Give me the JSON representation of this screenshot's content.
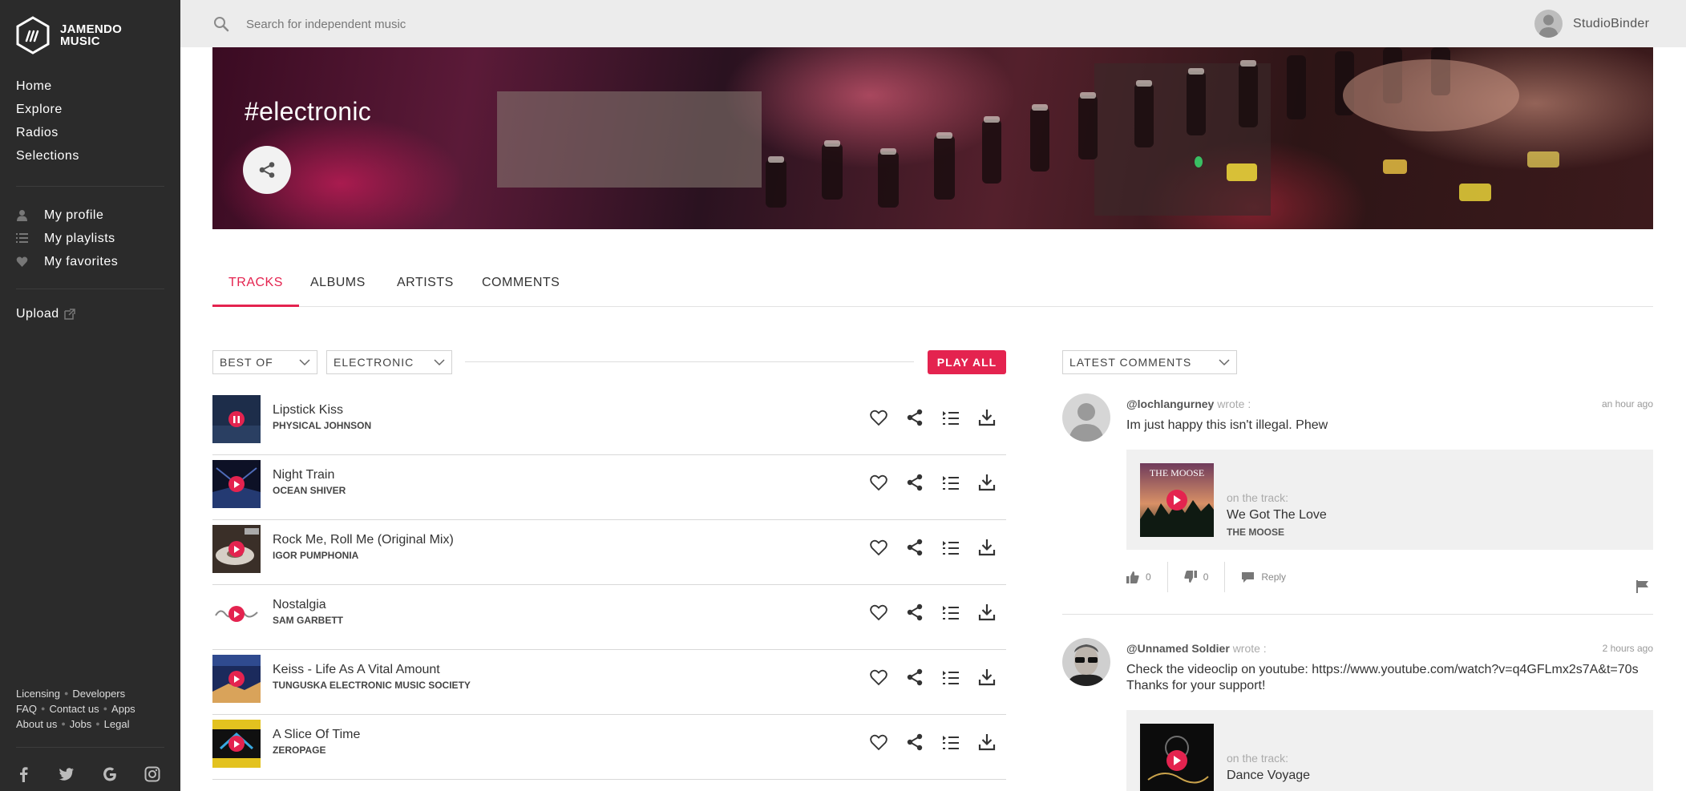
{
  "app": {
    "logo_line1": "JAMENDO",
    "logo_line2": "MUSIC"
  },
  "sidebar": {
    "main_nav": [
      "Home",
      "Explore",
      "Radios",
      "Selections"
    ],
    "user_nav": [
      "My profile",
      "My playlists",
      "My favorites"
    ],
    "upload": "Upload",
    "footer": {
      "row1": [
        "Licensing",
        "Developers"
      ],
      "row2": [
        "FAQ",
        "Contact us",
        "Apps"
      ],
      "row3": [
        "About us",
        "Jobs",
        "Legal"
      ]
    },
    "socials": [
      "facebook-icon",
      "twitter-icon",
      "google-plus-icon",
      "instagram-icon"
    ]
  },
  "search": {
    "placeholder": "Search for independent music",
    "value": ""
  },
  "user": {
    "name": "StudioBinder"
  },
  "banner": {
    "title": "#electronic"
  },
  "tabs": [
    "TRACKS",
    "ALBUMS",
    "ARTISTS",
    "COMMENTS"
  ],
  "active_tab": "TRACKS",
  "filters": {
    "sort": "BEST OF",
    "genre": "ELECTRONIC",
    "play_all": "PLAY ALL"
  },
  "tracks": [
    {
      "title": "Lipstick Kiss",
      "artist": "PHYSICAL JOHNSON",
      "state": "playing"
    },
    {
      "title": "Night Train",
      "artist": "OCEAN SHIVER",
      "state": "paused"
    },
    {
      "title": "Rock Me, Roll Me (Original Mix)",
      "artist": "IGOR PUMPHONIA",
      "state": "paused"
    },
    {
      "title": "Nostalgia",
      "artist": "SAM GARBETT",
      "state": "paused"
    },
    {
      "title": "Keiss - Life As A Vital Amount",
      "artist": "TUNGUSKA ELECTRONIC MUSIC SOCIETY",
      "state": "paused"
    },
    {
      "title": "A Slice Of Time",
      "artist": "ZEROPAGE",
      "state": "paused"
    }
  ],
  "comments_panel": {
    "sort": "LATEST COMMENTS",
    "comments": [
      {
        "user": "@lochlangurney",
        "wrote": "wrote :",
        "time": "an hour ago",
        "text": "Im just happy this isn't illegal. Phew",
        "on_track_label": "on the track:",
        "track_title": "We Got The Love",
        "track_artist": "THE MOOSE",
        "cover_text": "THE MOOSE",
        "likes": "0",
        "dislikes": "0",
        "reply": "Reply"
      },
      {
        "user": "@Unnamed Soldier",
        "wrote": "wrote :",
        "time": "2 hours ago",
        "text_line1": "Check the videoclip on youtube: https://www.youtube.com/watch?v=q4GFLmx2s7A&t=70s",
        "text_line2": "Thanks for your support!",
        "on_track_label": "on the track:",
        "track_title": "Dance Voyage"
      }
    ]
  },
  "colors": {
    "accent": "#e4234f",
    "sidebar_bg": "#2b2b2b",
    "topbar_bg": "#ececec"
  }
}
